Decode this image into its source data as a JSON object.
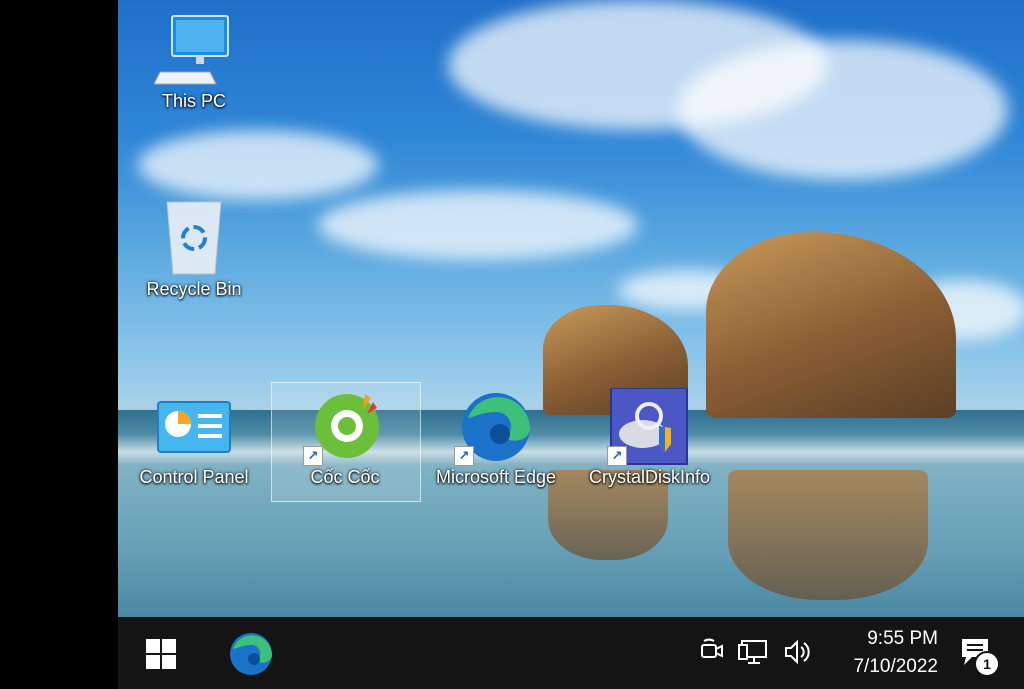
{
  "desktop": {
    "icons": [
      {
        "label": "This PC",
        "icon": "monitor-icon"
      },
      {
        "label": "Recycle Bin",
        "icon": "recycle-bin-icon"
      },
      {
        "label": "Control Panel",
        "icon": "control-panel-icon"
      },
      {
        "label": "Cốc Cốc",
        "icon": "coccoc-icon",
        "shortcut": true,
        "selected": true
      },
      {
        "label": "Microsoft Edge",
        "icon": "edge-icon",
        "shortcut": true
      },
      {
        "label": "CrystalDiskInfo",
        "icon": "crystaldiskinfo-icon",
        "shortcut": true
      }
    ]
  },
  "taskbar": {
    "start_icon": "windows-start-icon",
    "pinned": [
      {
        "icon": "edge-icon"
      }
    ],
    "tray": [
      "meet-now-icon",
      "network-icon",
      "volume-icon"
    ],
    "clock": {
      "time": "9:55 PM",
      "date": "7/10/2022"
    },
    "notifications": {
      "icon": "notification-center-icon",
      "count": "1"
    }
  },
  "colors": {
    "taskbar": "#141414",
    "edge_blue": "#1a73c8",
    "edge_green": "#3cc07a",
    "coccoc_green": "#6bbf3a"
  }
}
